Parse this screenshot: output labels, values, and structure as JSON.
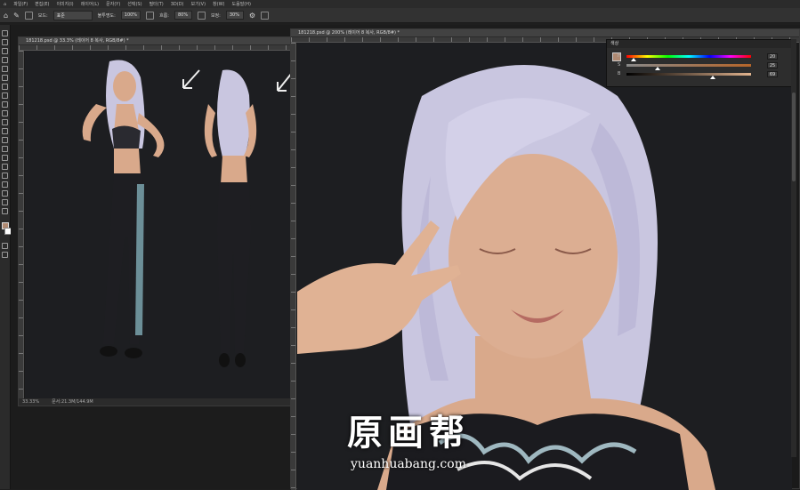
{
  "menubar": {
    "items": [
      "파일(F)",
      "편집(E)",
      "이미지(I)",
      "레이어(L)",
      "문자(Y)",
      "선택(S)",
      "필터(T)",
      "3D(D)",
      "보기(V)",
      "창(W)",
      "도움말(H)"
    ]
  },
  "options": {
    "mode_label": "모드:",
    "mode_value": "표준",
    "opacity_label": "불투명도:",
    "opacity_value": "100%",
    "flow_label": "흐름:",
    "flow_value": "80%",
    "smoothing_label": "보정:",
    "smoothing_value": "30%"
  },
  "doc_left": {
    "tab": "181218.psd @ 33.3% (레이어 8 복사, RGB/8#) *",
    "status_zoom": "33.33%",
    "status_doc": "문서:21.3M/144.9M"
  },
  "doc_right": {
    "tab": "181218.psd @ 200% (레이어 8 복사, RGB/8#) *"
  },
  "color_panel": {
    "title": "색상",
    "swatch_color": "#b08a72",
    "sliders": [
      {
        "label": "H",
        "value": "20",
        "fraction": 0.06
      },
      {
        "label": "S",
        "value": "25",
        "fraction": 0.25
      },
      {
        "label": "B",
        "value": "69",
        "fraction": 0.69
      }
    ]
  },
  "watermark": {
    "title": "原画帮",
    "url": "yuanhuabang.com"
  },
  "colors": {
    "hair": "#c9c6e0",
    "skin": "#d9a98b",
    "pants": "#1e1e22",
    "background": "#1d1e21"
  }
}
